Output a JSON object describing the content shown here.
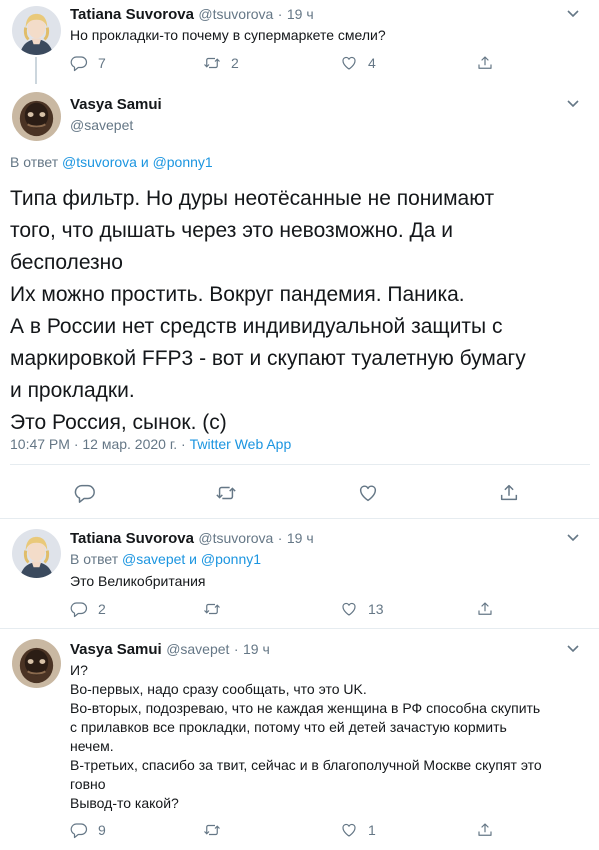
{
  "tweets": [
    {
      "name": "Tatiana Suvorova",
      "handle": "@tsuvorova",
      "time": "19 ч",
      "text": "Но прокладки-то почему в супермаркете смели?",
      "replies": "7",
      "retweets": "2",
      "likes": "4"
    },
    {
      "name": "Vasya Samui",
      "handle": "@savepet",
      "reply_prefix": "В ответ",
      "reply_user1": "@tsuvorova",
      "reply_and": "и",
      "reply_user2": "@ponny1",
      "lines": [
        "Типа фильтр. Но дуры неотёсанные не понимают",
        "того, что дышать через это невозможно. Да и",
        "бесполезно",
        "Их можно простить. Вокруг пандемия.  Паника.",
        "А в России нет средств индивидуальной защиты с",
        "маркировкой FFP3 - вот и скупают туалетную бумагу",
        "и прокладки.",
        "Это Россия, сынок. (с)"
      ],
      "timestamp": "10:47 PM · 12 мар. 2020 г.",
      "source": "Twitter Web App"
    },
    {
      "name": "Tatiana Suvorova",
      "handle": "@tsuvorova",
      "time": "19 ч",
      "reply_prefix": "В ответ",
      "reply_user1": "@savepet",
      "reply_and": "и",
      "reply_user2": "@ponny1",
      "text": "Это Великобритания",
      "replies": "2",
      "retweets": "",
      "likes": "13"
    },
    {
      "name": "Vasya Samui",
      "handle": "@savepet",
      "time": "19 ч",
      "lines": [
        "И?",
        "Во-первых, надо сразу сообщать, что это  UK.",
        "Во-вторых, подозреваю, что не каждая женщина в РФ способна скупить",
        "с прилавков все прокладки, потому что ей детей зачастую кормить",
        "нечем.",
        "В-третьих, спасибо за твит, сейчас и в благополучной Москве скупят это",
        "говно",
        "Вывод-то какой?"
      ],
      "replies": "9",
      "retweets": "",
      "likes": "1"
    }
  ],
  "colors": {
    "link": "#1b95e0",
    "muted": "#657786",
    "text": "#14171a"
  }
}
